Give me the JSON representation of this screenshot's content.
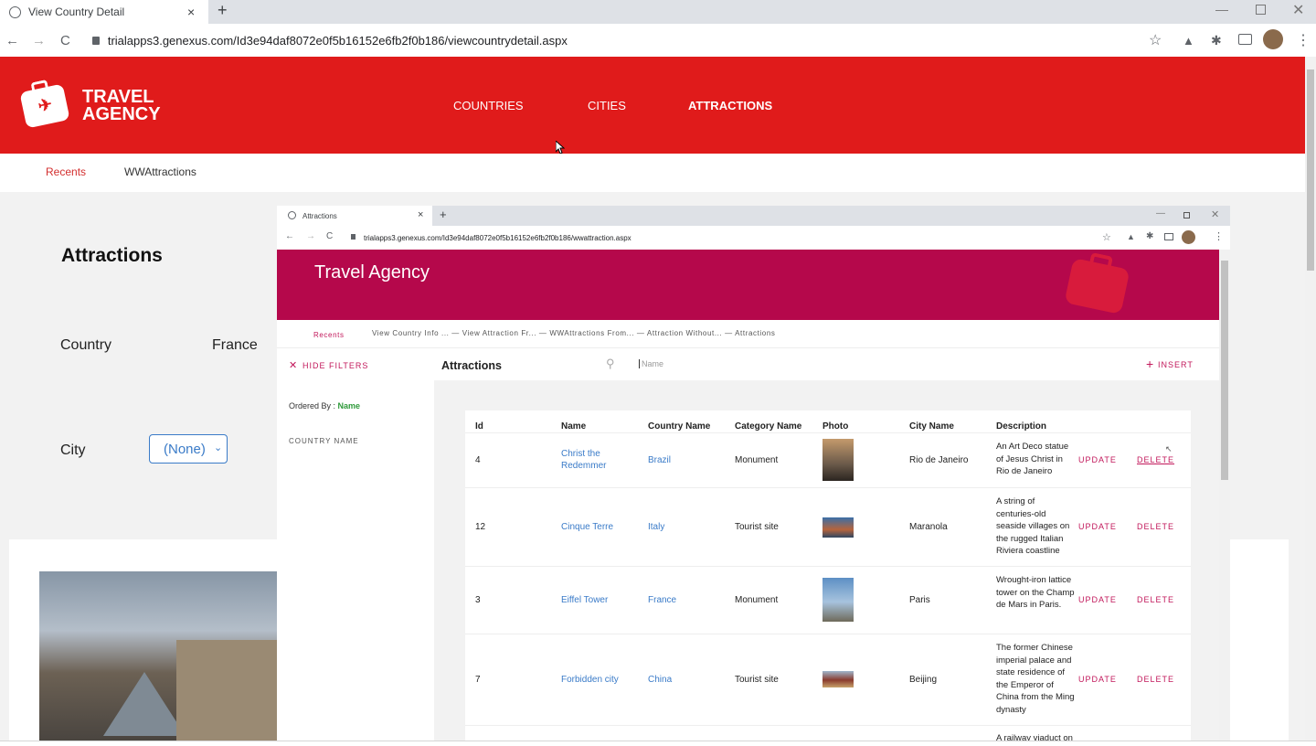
{
  "outer_browser": {
    "tab_title": "View Country Detail",
    "url": "trialapps3.genexus.com/Id3e94daf8072e0f5b16152e6fb2f0b186/viewcountrydetail.aspx"
  },
  "site_header": {
    "logo_line1": "TRAVEL",
    "logo_line2": "AGENCY",
    "nav": [
      "COUNTRIES",
      "CITIES",
      "ATTRACTIONS"
    ]
  },
  "subnav": {
    "recents": "Recents",
    "crumb": "WWAttractions"
  },
  "detail": {
    "heading": "Attractions",
    "country_label": "Country",
    "country_value": "France",
    "city_label": "City",
    "city_select": "(None)"
  },
  "inner_browser": {
    "tab_title": "Attractions",
    "url": "trialapps3.genexus.com/Id3e94daf8072e0f5b16152e6fb2f0b186/wwattraction.aspx",
    "banner_title": "Travel Agency",
    "breadcrumb_recents": "Recents",
    "breadcrumb": "View Country Info ... — View Attraction Fr... — WWAttractions From... — Attraction Without... — Attractions",
    "hide_filters": "HIDE FILTERS",
    "grid_title": "Attractions",
    "search_placeholder": "Name",
    "insert": "INSERT",
    "ordered_by_label": "Ordered By :",
    "ordered_by_value": "Name",
    "filter_country": "COUNTRY NAME",
    "columns": [
      "Id",
      "Name",
      "Country Name",
      "Category Name",
      "Photo",
      "City Name",
      "Description"
    ],
    "update_label": "UPDATE",
    "delete_label": "DELETE",
    "rows": [
      {
        "id": "4",
        "name": "Christ the Redemmer",
        "country": "Brazil",
        "category": "Monument",
        "city": "Rio de Janeiro",
        "description": "An Art Deco statue of Jesus Christ in Rio de Janeiro"
      },
      {
        "id": "12",
        "name": "Cinque Terre",
        "country": "Italy",
        "category": "Tourist site",
        "city": "Maranola",
        "description": "A string of centuries-old seaside villages on the rugged Italian Riviera coastline"
      },
      {
        "id": "3",
        "name": "Eiffel Tower",
        "country": "France",
        "category": "Monument",
        "city": "Paris",
        "description": "Wrought-iron lattice tower on the Champ de Mars in Paris."
      },
      {
        "id": "7",
        "name": "Forbidden city",
        "country": "China",
        "category": "Tourist site",
        "city": "Beijing",
        "description": "The former Chinese imperial palace and state residence of the Emperor of China from the Ming dynasty"
      }
    ],
    "partial_row_description": "A railway viaduct on"
  }
}
